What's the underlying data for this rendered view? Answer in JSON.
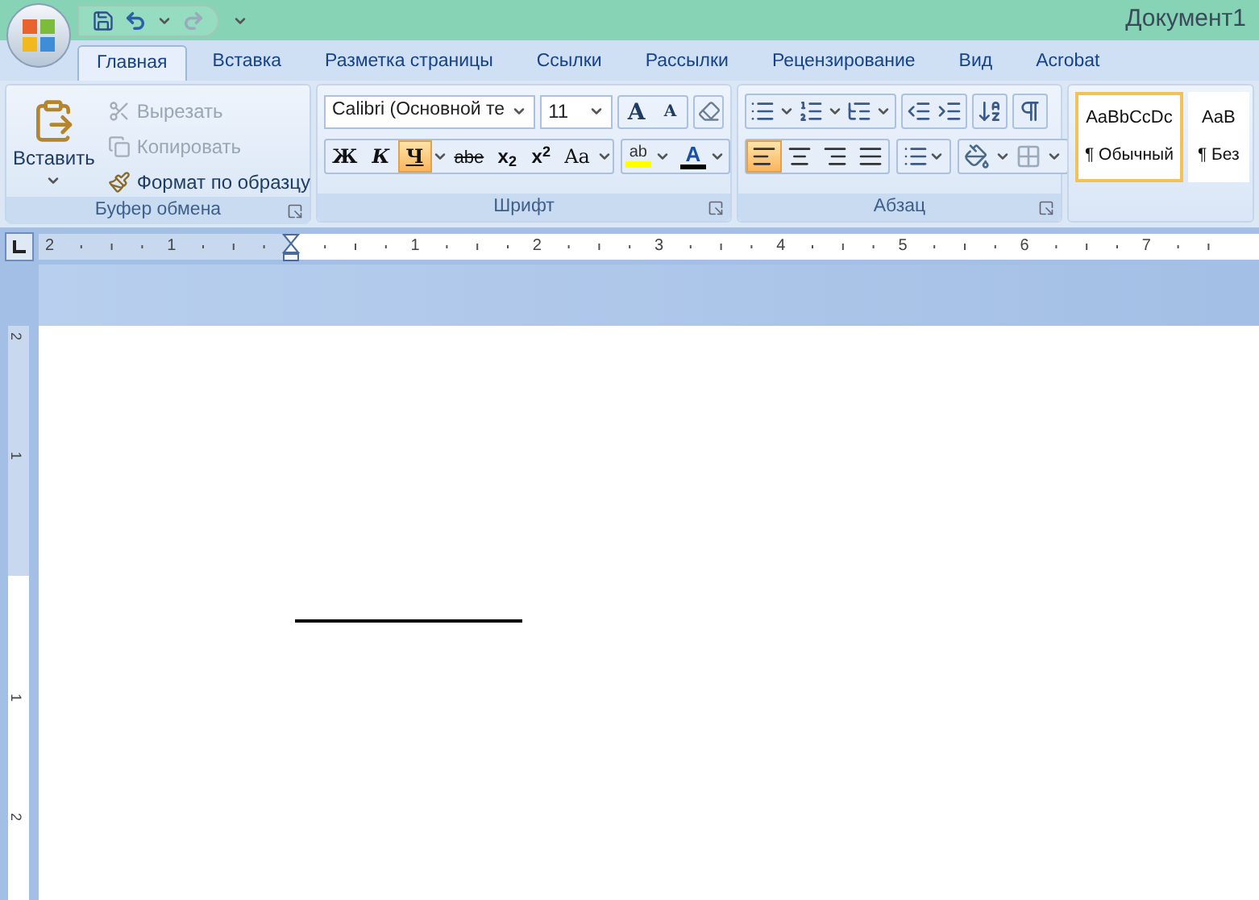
{
  "window": {
    "title": "Документ1"
  },
  "tabs": [
    {
      "label": "Главная",
      "selected": true
    },
    {
      "label": "Вставка",
      "selected": false
    },
    {
      "label": "Разметка страницы",
      "selected": false
    },
    {
      "label": "Ссылки",
      "selected": false
    },
    {
      "label": "Рассылки",
      "selected": false
    },
    {
      "label": "Рецензирование",
      "selected": false
    },
    {
      "label": "Вид",
      "selected": false
    },
    {
      "label": "Acrobat",
      "selected": false
    }
  ],
  "clipboard": {
    "paste": "Вставить",
    "title": "Буфер обмена",
    "items": [
      {
        "kind": "cut",
        "label": "Вырезать",
        "disabled": true
      },
      {
        "kind": "copy",
        "label": "Копировать",
        "disabled": true
      },
      {
        "kind": "painter",
        "label": "Формат по образцу",
        "disabled": false
      }
    ]
  },
  "font": {
    "name": "Calibri (Основной те",
    "size": "11",
    "grow": "A",
    "shrink": "A",
    "highlight": "ab",
    "color_letter": "A",
    "title": "Шрифт",
    "format_buttons": [
      {
        "kind": "bold",
        "label": "Ж",
        "selected": false
      },
      {
        "kind": "italic",
        "label": "К",
        "selected": false
      },
      {
        "kind": "underline",
        "label": "Ч",
        "selected": true
      },
      {
        "kind": "strike",
        "label": "abe",
        "selected": false
      },
      {
        "kind": "sub",
        "label": "x$_{2}$",
        "selected": false
      },
      {
        "kind": "sup",
        "label": "x$^{2}$",
        "selected": false
      },
      {
        "kind": "case",
        "label": "Aa",
        "selected": false
      }
    ]
  },
  "paragraph": {
    "title": "Абзац",
    "alignments": [
      {
        "kind": "left",
        "selected": true
      },
      {
        "kind": "center",
        "selected": false
      },
      {
        "kind": "right",
        "selected": false
      },
      {
        "kind": "justify",
        "selected": false
      }
    ]
  },
  "styles": [
    {
      "sample": "AaBbCcDc",
      "name": "¶ Обычный",
      "selected": true
    },
    {
      "sample": "AaB",
      "name": "¶ Без",
      "selected": false
    }
  ],
  "ruler": {
    "horizontal": [
      "2",
      "1",
      "1",
      "2",
      "3",
      "4",
      "5",
      "6",
      "7"
    ],
    "vertical": [
      "2",
      "1",
      "1",
      "2"
    ]
  }
}
